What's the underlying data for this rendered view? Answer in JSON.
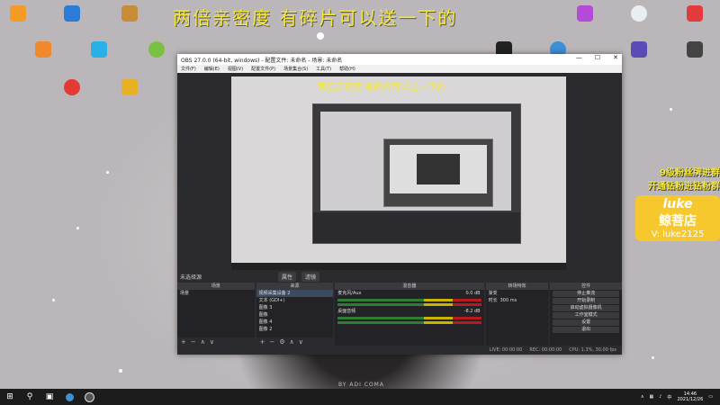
{
  "desktop": {
    "banner": "两倍亲密度 有碎片可以送一下的",
    "promo": {
      "line1": "9级粉丝牌进群",
      "line2": "开通钻粉进钻粉群",
      "brand_top": "luke",
      "brand_mid": "鲸菩店",
      "brand_bot": "V: luke2125"
    },
    "credit": "BY ADI COMA"
  },
  "obs": {
    "title": "OBS 27.0.0 (64-bit, windows) - 配置文件: 未命名 - 场景: 未命名",
    "menu": [
      "文件(F)",
      "编辑(E)",
      "视图(V)",
      "配置文件(P)",
      "场景集合(S)",
      "工具(T)",
      "帮助(H)"
    ],
    "window_buttons": [
      "—",
      "☐",
      "✕"
    ],
    "no_source": "未选择源",
    "properties_btn": "属性",
    "filters_btn": "滤镜",
    "docks": {
      "scenes": {
        "header": "场景",
        "items": [
          "场景"
        ]
      },
      "sources": {
        "header": "来源",
        "items": [
          "视频采集设备 2",
          "文本 (GDI+)",
          "图像 3",
          "图像",
          "图像 4",
          "图像 2"
        ]
      },
      "mixer": {
        "header": "混音器",
        "ch1": "桌面音频",
        "ch1_db": "-8.2 dB",
        "ch2": "麦克风/Aux",
        "ch2_db": "0.0 dB"
      },
      "transitions": {
        "header": "转场特效",
        "type": "渐变",
        "duration_label": "时长",
        "duration": "300 ms"
      },
      "controls": {
        "header": "控件",
        "buttons": [
          "停止推流",
          "开始录制",
          "启动虚拟摄像机",
          "工作室模式",
          "设置",
          "退出"
        ]
      }
    },
    "status": {
      "live": "LIVE: 00:00:00",
      "rec": "REC: 00:00:00",
      "cpu": "CPU: 1.3%, 30.00 fps"
    }
  },
  "taskbar": {
    "time": "14:46",
    "date": "2021/12/26",
    "lang": "中"
  }
}
